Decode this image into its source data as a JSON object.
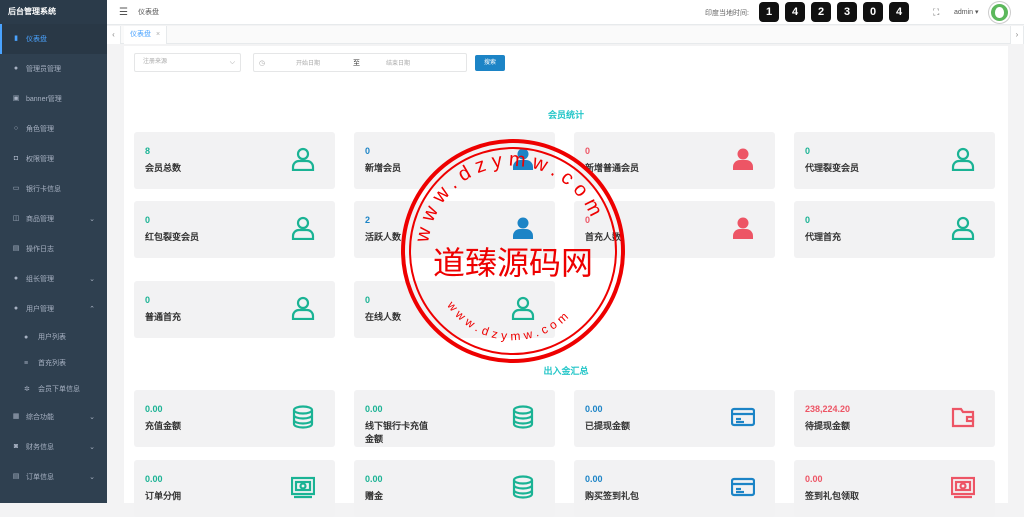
{
  "app_title": "后台管理系统",
  "sidebar": {
    "items": [
      {
        "label": "仪表盘",
        "icon": "bar-chart-icon",
        "active": true
      },
      {
        "label": "管理员管理",
        "icon": "user-icon"
      },
      {
        "label": "banner管理",
        "icon": "image-icon"
      },
      {
        "label": "角色管理",
        "icon": "person-outline-icon"
      },
      {
        "label": "权限管理",
        "icon": "lock-icon"
      },
      {
        "label": "银行卡信息",
        "icon": "credit-card-icon"
      },
      {
        "label": "商品管理",
        "icon": "gift-icon",
        "expandable": true
      },
      {
        "label": "操作日志",
        "icon": "file-icon"
      },
      {
        "label": "组长管理",
        "icon": "user-icon",
        "expandable": true
      },
      {
        "label": "用户管理",
        "icon": "user-icon",
        "expandable": true,
        "expanded": true
      }
    ],
    "subitems": [
      {
        "label": "用户列表",
        "icon": "user-icon"
      },
      {
        "label": "首充列表",
        "icon": "list-icon"
      },
      {
        "label": "会员下单信息",
        "icon": "gear-icon"
      }
    ],
    "items2": [
      {
        "label": "综合功能",
        "icon": "grid-icon",
        "expandable": true
      },
      {
        "label": "财务信息",
        "icon": "money-icon",
        "expandable": true
      },
      {
        "label": "订单信息",
        "icon": "file-icon",
        "expandable": true
      }
    ]
  },
  "header": {
    "breadcrumb": "仪表盘",
    "clock_label": "印度当地时间:",
    "clock_digits": [
      "1",
      "4",
      "2",
      "3",
      "0",
      "4"
    ],
    "user": "admin"
  },
  "tabs": [
    {
      "label": "仪表盘"
    }
  ],
  "filter": {
    "source_placeholder": "注册来源",
    "start_placeholder": "开始日期",
    "to": "至",
    "end_placeholder": "结束日期",
    "search_label": "搜索"
  },
  "member_section": {
    "title": "会员统计",
    "cards": [
      {
        "value": "8",
        "label": "会员总数",
        "icon": "user-outline-icon",
        "color": "#1ab394"
      },
      {
        "value": "0",
        "label": "新增会员",
        "icon": "user-solid-icon",
        "color": "#1c84c6"
      },
      {
        "value": "0",
        "label": "新增普通会员",
        "icon": "user-solid-icon",
        "color": "#ed5565"
      },
      {
        "value": "0",
        "label": "代理裂变会员",
        "icon": "user-outline-icon",
        "color": "#1ab394"
      },
      {
        "value": "0",
        "label": "红包裂变会员",
        "icon": "user-outline-icon",
        "color": "#1ab394"
      },
      {
        "value": "2",
        "label": "活跃人数",
        "icon": "user-solid-icon",
        "color": "#1c84c6"
      },
      {
        "value": "0",
        "label": "首充人数",
        "icon": "user-solid-icon",
        "color": "#ed5565"
      },
      {
        "value": "0",
        "label": "代理首充",
        "icon": "user-outline-icon",
        "color": "#1ab394"
      },
      {
        "value": "0",
        "label": "普通首充",
        "icon": "user-outline-icon",
        "color": "#1ab394"
      },
      {
        "value": "0",
        "label": "在线人数",
        "icon": "user-outline-icon",
        "color": "#1ab394"
      }
    ]
  },
  "finance_section": {
    "title": "出入金汇总",
    "cards": [
      {
        "value": "0.00",
        "label": "充值金额",
        "icon": "coins-icon",
        "color": "#1ab394"
      },
      {
        "value": "0.00",
        "label": "线下银行卡充值金额",
        "icon": "coins-icon",
        "color": "#1ab394"
      },
      {
        "value": "0.00",
        "label": "已提现金额",
        "icon": "credit-card-icon",
        "color": "#1c84c6"
      },
      {
        "value": "238,224.20",
        "label": "待提现金额",
        "icon": "wallet-icon",
        "color": "#ed5565"
      },
      {
        "value": "0.00",
        "label": "订单分佣",
        "icon": "cash-icon",
        "color": "#1ab394"
      },
      {
        "value": "0.00",
        "label": "赠金",
        "icon": "coins-icon",
        "color": "#1ab394"
      },
      {
        "value": "0.00",
        "label": "购买签到礼包",
        "icon": "credit-card-icon",
        "color": "#1c84c6"
      },
      {
        "value": "0.00",
        "label": "签到礼包领取",
        "icon": "cash-icon",
        "color": "#ed5565"
      }
    ]
  },
  "watermark": {
    "text": "道臻源码网",
    "url_top": "www.dzymw.com",
    "url_bottom": "www.dzymw.com"
  }
}
